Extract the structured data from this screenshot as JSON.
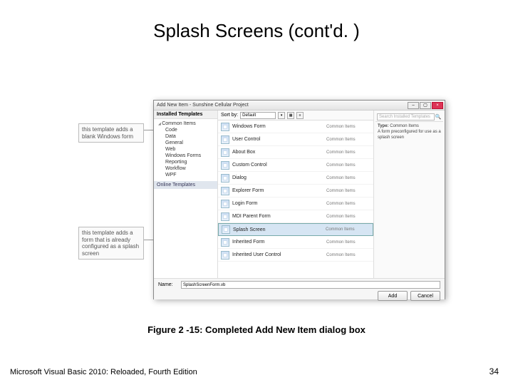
{
  "slide": {
    "title": "Splash Screens (cont'd. )",
    "caption": "Figure 2 -15: Completed Add New Item dialog box",
    "footer_text": "Microsoft Visual Basic 2010: Reloaded, Fourth Edition",
    "page_num": "34"
  },
  "callouts": {
    "top": "this template adds a blank Windows form",
    "bottom": "this template  adds a form that is already configured as a splash screen"
  },
  "dialog": {
    "title": "Add New Item - Sunshine Cellular Project",
    "left": {
      "head": "Installed Templates",
      "parent": "Common Items",
      "children": [
        "Code",
        "Data",
        "General",
        "Web",
        "Windows Forms",
        "Reporting",
        "Workflow",
        "WPF"
      ],
      "online": "Online Templates"
    },
    "sort": {
      "label": "Sort by:",
      "value": "Default"
    },
    "templates": [
      {
        "name": "Windows Form",
        "cat": "Common Items"
      },
      {
        "name": "User Control",
        "cat": "Common Items"
      },
      {
        "name": "About Box",
        "cat": "Common Items"
      },
      {
        "name": "Custom Control",
        "cat": "Common Items"
      },
      {
        "name": "Dialog",
        "cat": "Common Items"
      },
      {
        "name": "Explorer Form",
        "cat": "Common Items"
      },
      {
        "name": "Login Form",
        "cat": "Common Items"
      },
      {
        "name": "MDI Parent Form",
        "cat": "Common Items"
      },
      {
        "name": "Splash Screen",
        "cat": "Common Items"
      },
      {
        "name": "Inherited Form",
        "cat": "Common Items"
      },
      {
        "name": "Inherited User Control",
        "cat": "Common Items"
      }
    ],
    "selected_index": 8,
    "search_placeholder": "Search Installed Templates",
    "info": {
      "type_label": "Type:",
      "type_value": "Common Items",
      "desc": "A form preconfigured for use as a splash screen"
    },
    "name": {
      "label": "Name:",
      "value": "SplashScreenForm.vb"
    },
    "buttons": {
      "add": "Add",
      "cancel": "Cancel"
    }
  }
}
